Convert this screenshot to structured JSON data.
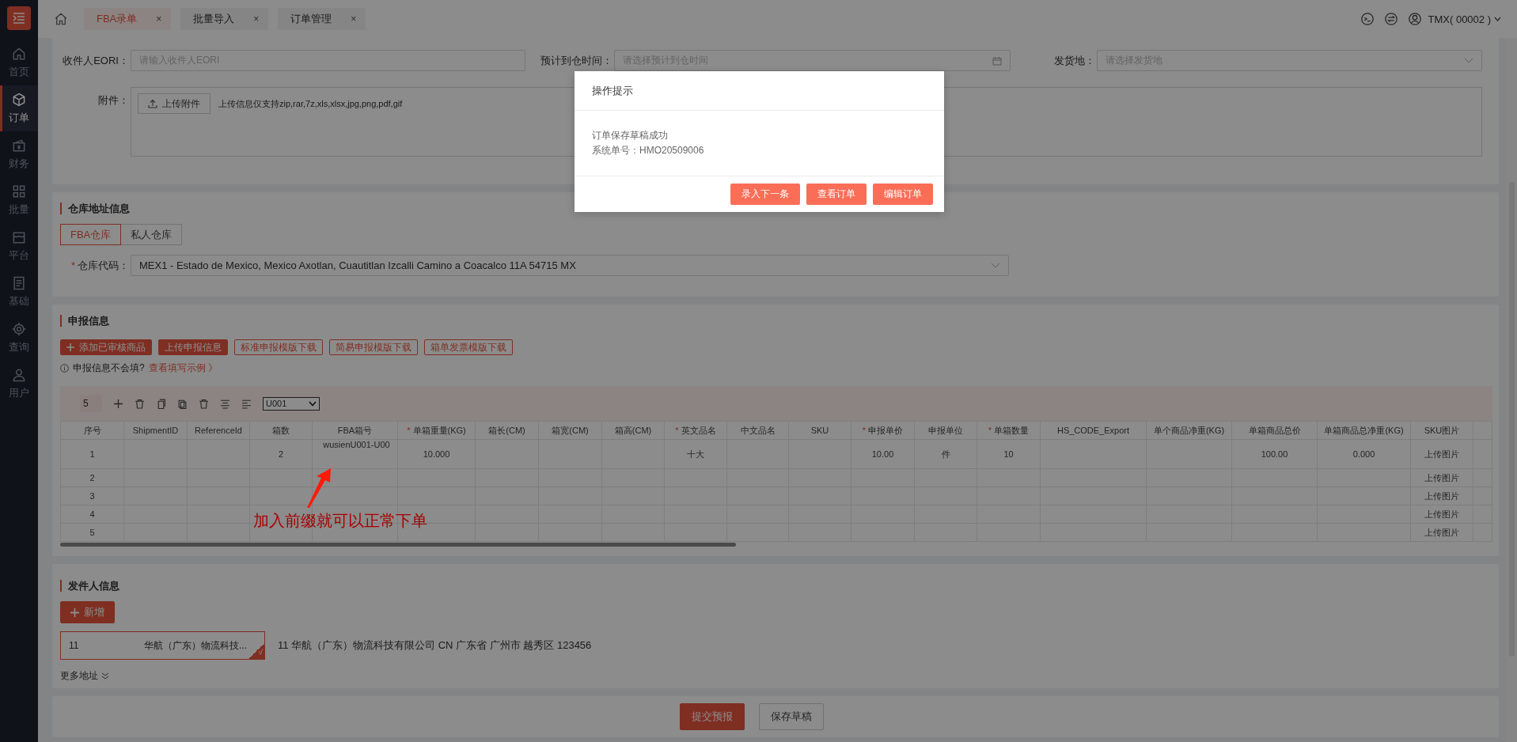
{
  "sidebar": {
    "items": [
      {
        "label": "首页",
        "selected": false
      },
      {
        "label": "订单",
        "selected": true
      },
      {
        "label": "财务",
        "selected": false
      },
      {
        "label": "批量",
        "selected": false
      },
      {
        "label": "平台",
        "selected": false
      },
      {
        "label": "基础",
        "selected": false
      },
      {
        "label": "查询",
        "selected": false
      },
      {
        "label": "用户",
        "selected": false
      }
    ]
  },
  "tabs": [
    {
      "label": "FBA录单",
      "selected": true,
      "close": "×"
    },
    {
      "label": "批量导入",
      "selected": false,
      "close": "×"
    },
    {
      "label": "订单管理",
      "selected": false,
      "close": "×"
    }
  ],
  "user": {
    "name": "TMX( 00002 )"
  },
  "order_form": {
    "eori": {
      "label": "收件人EORI：",
      "placeholder": "请输入收件人EORI"
    },
    "arrival_time": {
      "label": "预计到仓时间：",
      "placeholder": "请选择预计到仓时间"
    },
    "origin": {
      "label": "发货地：",
      "placeholder": "请选择发货地"
    },
    "attachment": {
      "label": "附件：",
      "button": "上传附件",
      "hint": "上传信息仅支持zip,rar,7z,xls,xlsx,jpg,png,pdf,gif"
    }
  },
  "warehouse": {
    "title": "仓库地址信息",
    "tabs": [
      {
        "label": "FBA仓库",
        "selected": true
      },
      {
        "label": "私人仓库",
        "selected": false
      }
    ],
    "code_label": "仓库代码：",
    "code_mark": "*",
    "code_value": "MEX1 - Estado de Mexico, Mexico Axotlan, Cuautitlan Izcalli Camino a Coacalco 11A 54715 MX"
  },
  "declaration": {
    "title": "申报信息",
    "buttons": [
      {
        "label": "添加已审核商品",
        "kind": "filled",
        "plus": true
      },
      {
        "label": "上传申报信息",
        "kind": "filled",
        "plus": false
      },
      {
        "label": "标准申报模版下载",
        "kind": "outline",
        "plus": false
      },
      {
        "label": "简易申报模版下载",
        "kind": "outline",
        "plus": false
      },
      {
        "label": "箱单发票模版下载",
        "kind": "outline",
        "plus": false
      }
    ],
    "hint": "申报信息不会填?",
    "hint_link": "查看填写示例 》",
    "toolbar": {
      "count": "5",
      "unit": "U001"
    },
    "table": {
      "columns": [
        {
          "label": "序号"
        },
        {
          "label": "ShipmentID"
        },
        {
          "label": "ReferenceId"
        },
        {
          "label": "箱数"
        },
        {
          "label": "FBA箱号"
        },
        {
          "label": "单箱重量(KG)",
          "required_mark": "*"
        },
        {
          "label": "箱长(CM)"
        },
        {
          "label": "箱宽(CM)"
        },
        {
          "label": "箱高(CM)"
        },
        {
          "label": "英文品名",
          "required_mark": "*"
        },
        {
          "label": "中文品名"
        },
        {
          "label": "SKU"
        },
        {
          "label": "申报单价",
          "required_mark": "*"
        },
        {
          "label": "申报单位"
        },
        {
          "label": "单箱数量",
          "required_mark": "*"
        },
        {
          "label": "HS_CODE_Export"
        },
        {
          "label": "单个商品净重(KG)"
        },
        {
          "label": "单箱商品总价"
        },
        {
          "label": "单箱商品总净重(KG)"
        },
        {
          "label": "SKU图片"
        }
      ],
      "rows": [
        {
          "cells": [
            "1",
            null,
            null,
            "2",
            "wusienU001-U00",
            "10.000",
            null,
            null,
            null,
            "十大",
            null,
            null,
            "10.00",
            "件",
            "10",
            null,
            null,
            "100.00",
            "0.000",
            "上传图片"
          ]
        },
        {
          "cells": [
            "2",
            null,
            null,
            null,
            null,
            null,
            null,
            null,
            null,
            null,
            null,
            null,
            null,
            null,
            null,
            null,
            null,
            null,
            null,
            "上传图片"
          ]
        },
        {
          "cells": [
            "3",
            null,
            null,
            null,
            null,
            null,
            null,
            null,
            null,
            null,
            null,
            null,
            null,
            null,
            null,
            null,
            null,
            null,
            null,
            "上传图片"
          ]
        },
        {
          "cells": [
            "4",
            null,
            null,
            null,
            null,
            null,
            null,
            null,
            null,
            null,
            null,
            null,
            null,
            null,
            null,
            null,
            null,
            null,
            null,
            "上传图片"
          ]
        },
        {
          "cells": [
            "5",
            null,
            null,
            null,
            null,
            null,
            null,
            null,
            null,
            null,
            null,
            null,
            null,
            null,
            null,
            null,
            null,
            null,
            null,
            "上传图片"
          ]
        }
      ]
    }
  },
  "sender": {
    "title": "发件人信息",
    "add_button": "新增",
    "cards": [
      {
        "code": "11",
        "name": "华航（广东）物流科技...",
        "selected": true,
        "check": "√"
      }
    ],
    "address": "11 华航（广东）物流科技有限公司 CN 广东省 广州市 越秀区 123456",
    "more": "更多地址"
  },
  "actions": [
    {
      "label": "提交预报",
      "kind": "primary"
    },
    {
      "label": "保存草稿",
      "kind": "default"
    }
  ],
  "dialog": {
    "title": "操作提示",
    "message": "订单保存草稿成功",
    "order_no": "系统单号：HMO20509006",
    "buttons": [
      "录入下一条",
      "查看订单",
      "编辑订单"
    ]
  },
  "annotation": {
    "text": "加入前缀就可以正常下单"
  }
}
